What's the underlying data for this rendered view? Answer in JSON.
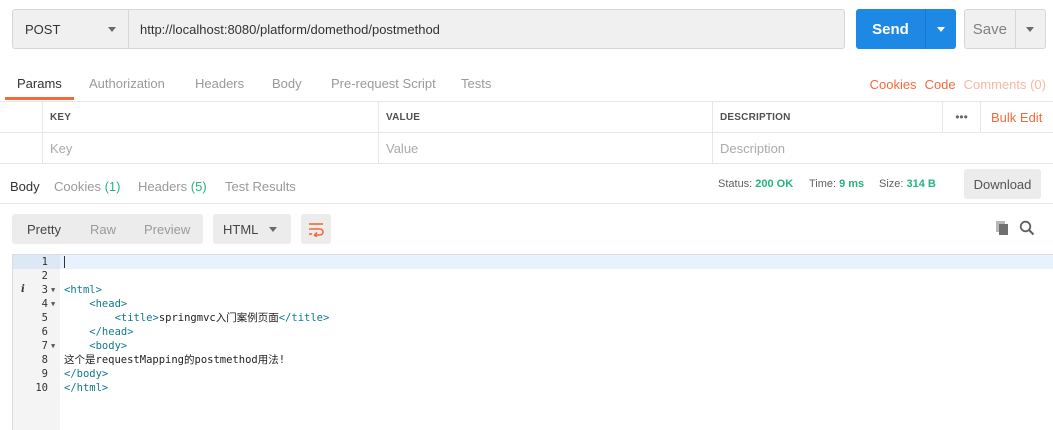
{
  "request": {
    "method": "POST",
    "url": "http://localhost:8080/platform/domethod/postmethod",
    "send_label": "Send",
    "save_label": "Save"
  },
  "request_tabs": {
    "params": "Params",
    "authorization": "Authorization",
    "headers": "Headers",
    "body": "Body",
    "pre_request": "Pre-request Script",
    "tests": "Tests",
    "cookies": "Cookies",
    "code": "Code",
    "comments": "Comments (0)"
  },
  "params_table": {
    "key_header": "KEY",
    "value_header": "VALUE",
    "description_header": "DESCRIPTION",
    "more": "•••",
    "bulk_edit": "Bulk Edit",
    "key_placeholder": "Key",
    "value_placeholder": "Value",
    "description_placeholder": "Description"
  },
  "response_tabs": {
    "body": "Body",
    "cookies": "Cookies",
    "cookies_count": "(1)",
    "headers": "Headers",
    "headers_count": "(5)",
    "test_results": "Test Results"
  },
  "response_meta": {
    "status_label": "Status:",
    "status_value": "200 OK",
    "time_label": "Time:",
    "time_value": "9 ms",
    "size_label": "Size:",
    "size_value": "314 B",
    "download": "Download"
  },
  "format": {
    "pretty": "Pretty",
    "raw": "Raw",
    "preview": "Preview",
    "language": "HTML"
  },
  "colors": {
    "accent": "#f26b3a",
    "send": "#1e88e5",
    "success": "#26b47f"
  },
  "code_lines": [
    {
      "n": "1",
      "open": "",
      "text": "",
      "close": "",
      "tail": ""
    },
    {
      "n": "2",
      "open": "",
      "text": "",
      "close": "",
      "tail": ""
    },
    {
      "n": "3",
      "open": "<html>",
      "text": "",
      "close": "",
      "tail": ""
    },
    {
      "n": "4",
      "open": "    <head>",
      "text": "",
      "close": "",
      "tail": ""
    },
    {
      "n": "5",
      "open": "        <title>",
      "text": "springmvc入门案例页面",
      "close": "</title>",
      "tail": ""
    },
    {
      "n": "6",
      "open": "    </head>",
      "text": "",
      "close": "",
      "tail": ""
    },
    {
      "n": "7",
      "open": "    <body>",
      "text": "",
      "close": "",
      "tail": ""
    },
    {
      "n": "8",
      "open": "",
      "text": "这个是requestMapping的postmethod用法!",
      "close": "",
      "tail": ""
    },
    {
      "n": "9",
      "open": "</body>",
      "text": "",
      "close": "",
      "tail": ""
    },
    {
      "n": "10",
      "open": "</html>",
      "text": "",
      "close": "",
      "tail": ""
    }
  ]
}
